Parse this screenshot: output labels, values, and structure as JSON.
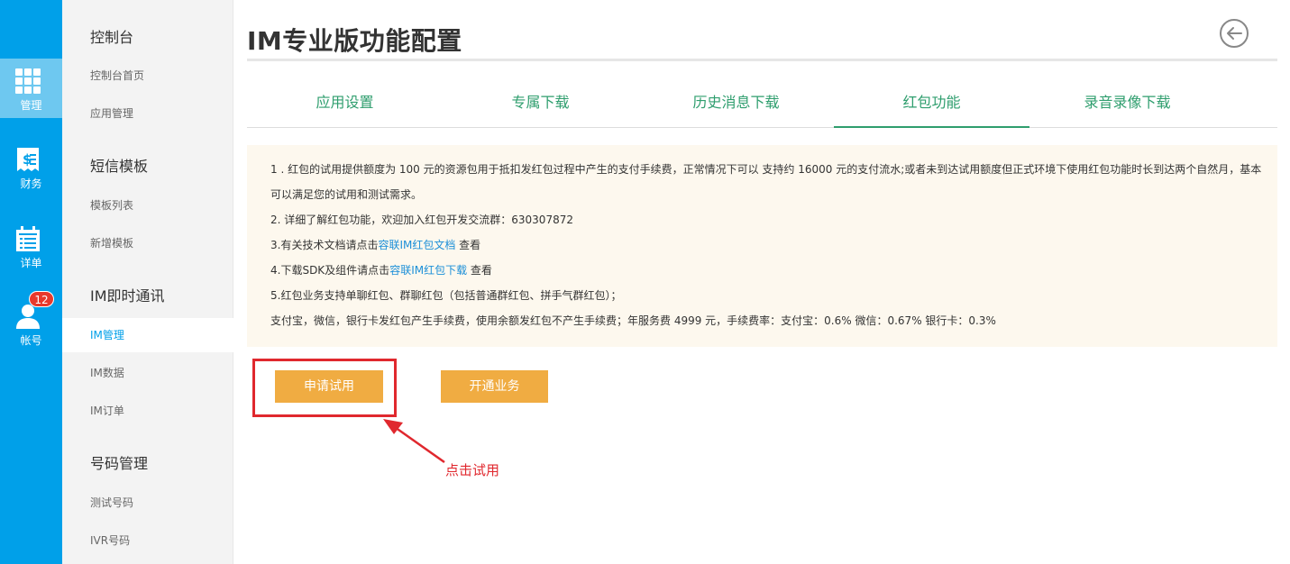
{
  "rail": {
    "items": [
      {
        "label": "管理",
        "icon": "grid-icon"
      },
      {
        "label": "财务",
        "icon": "receipt-icon"
      },
      {
        "label": "详单",
        "icon": "calendar-list-icon"
      },
      {
        "label": "帐号",
        "icon": "user-icon",
        "badge": "12"
      }
    ]
  },
  "subnav": {
    "groups": [
      {
        "title": "控制台",
        "items": [
          "控制台首页",
          "应用管理"
        ]
      },
      {
        "title": "短信模板",
        "items": [
          "模板列表",
          "新增模板"
        ]
      },
      {
        "title": "IM即时通讯",
        "items": [
          "IM管理",
          "IM数据",
          "IM订单"
        ]
      },
      {
        "title": "号码管理",
        "items": [
          "测试号码",
          "IVR号码"
        ]
      }
    ],
    "active": "IM管理"
  },
  "main": {
    "title": "IM专业版功能配置",
    "back_icon": "back-arrow-icon",
    "tabs": [
      "应用设置",
      "专属下载",
      "历史消息下载",
      "红包功能",
      "录音录像下载"
    ],
    "active_tab": "红包功能",
    "notice": {
      "line1a": "1 . 红包的试用提供额度为 100 元的资源包用于抵扣发红包过程中产生的支付手续费，正常情况下可以 支持约 16000 元的支付流水;或者未到达试用额度但正式环境下使用红包功能时长到达两个自然月，基本",
      "line1b": "可以满足您的试用和测试需求。",
      "line2": "2. 详细了解红包功能，欢迎加入红包开发交流群：630307872",
      "line3_pre": "3.有关技术文档请点击",
      "line3_link": "容联IM红包文档",
      "line3_post": " 查看",
      "line4_pre": "4.下载SDK及组件请点击",
      "line4_link": "容联IM红包下载",
      "line4_post": " 查看",
      "line5": "5.红包业务支持单聊红包、群聊红包（包括普通群红包、拼手气群红包）；",
      "line6": "支付宝，微信，银行卡发红包产生手续费，使用余额发红包不产生手续费；年服务费 4999 元，手续费率：支付宝：0.6% 微信：0.67% 银行卡：0.3%"
    },
    "buttons": {
      "trial": "申请试用",
      "open": "开通业务"
    },
    "callout": "点击试用"
  },
  "colors": {
    "rail": "#00a0e9",
    "accent_green": "#2f9e6e",
    "button": "#f0ac42",
    "annotation": "#e0282e"
  }
}
